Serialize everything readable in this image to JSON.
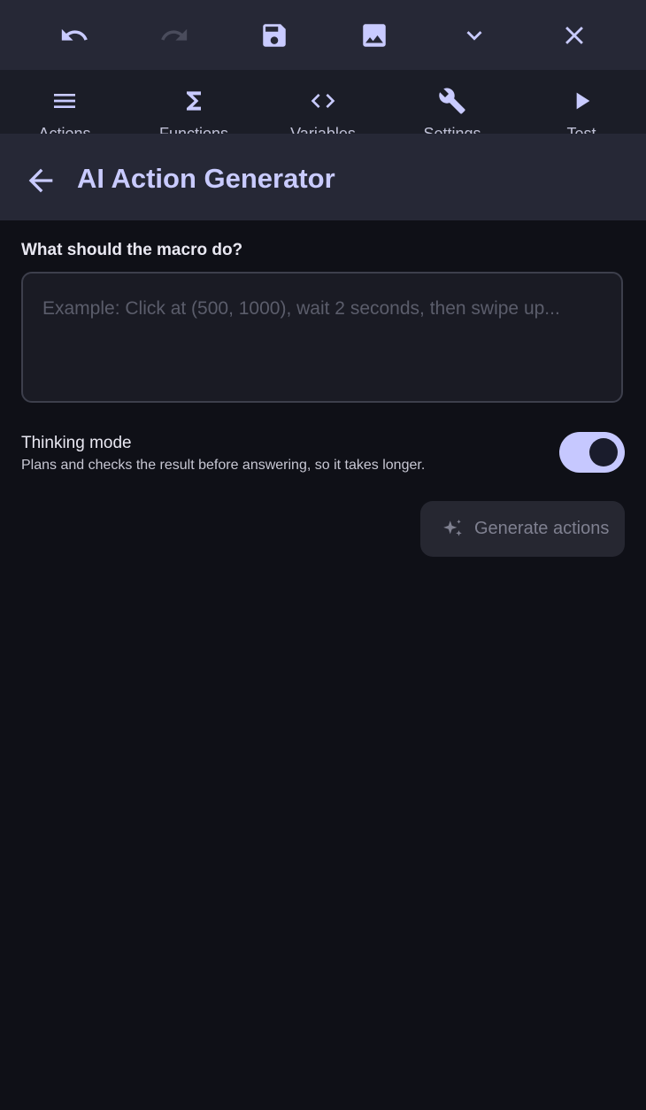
{
  "toolbar": {
    "buttons": [
      {
        "icon": "undo-icon"
      },
      {
        "icon": "redo-icon"
      },
      {
        "icon": "save-icon"
      },
      {
        "icon": "image-icon"
      },
      {
        "icon": "chevron-down-icon"
      },
      {
        "icon": "close-icon"
      }
    ]
  },
  "tabs": [
    {
      "label": "Actions",
      "icon": "menu-icon"
    },
    {
      "label": "Functions",
      "icon": "sigma-icon"
    },
    {
      "label": "Variables",
      "icon": "code-icon"
    },
    {
      "label": "Settings",
      "icon": "wrench-icon"
    },
    {
      "label": "Test",
      "icon": "play-icon"
    }
  ],
  "header": {
    "title": "AI Action Generator"
  },
  "form": {
    "question": "What should the macro do?",
    "placeholder": "Example: Click at (500, 1000), wait 2 seconds, then swipe up...",
    "thinking_title": "Thinking mode",
    "thinking_description": "Plans and checks the result before answering, so it takes longer.",
    "thinking_enabled": true,
    "generate_label": "Generate actions"
  },
  "colors": {
    "accent": "#c9cbff",
    "background": "#0f1017",
    "bar": "#262836"
  }
}
